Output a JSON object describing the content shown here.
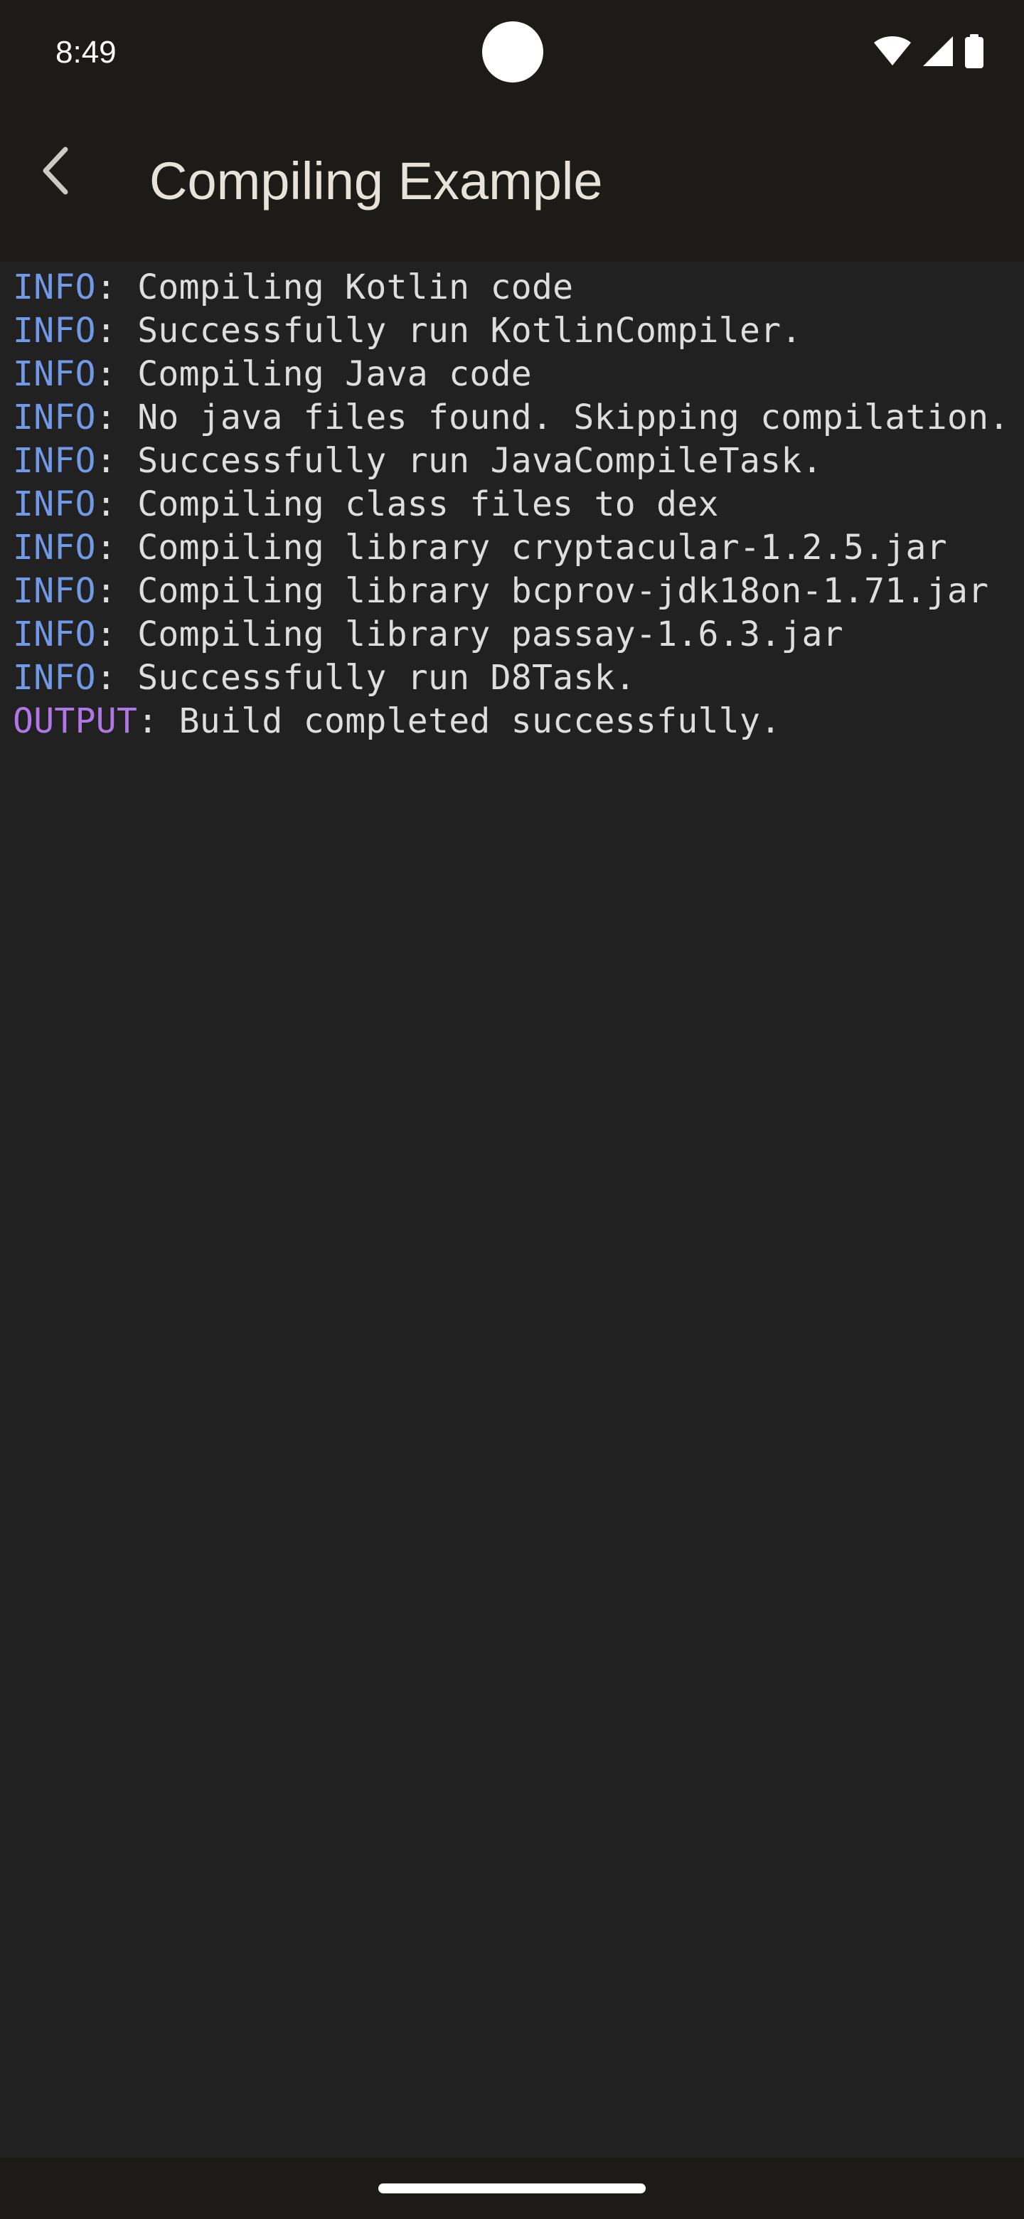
{
  "status_bar": {
    "time": "8:49",
    "icons": [
      "wifi-icon",
      "signal-icon",
      "battery-icon"
    ]
  },
  "app_bar": {
    "back_icon": "arrow-back-icon",
    "title": "Compiling Example"
  },
  "console": {
    "lines": [
      {
        "level": "INFO",
        "sep": ": ",
        "message": "Compiling Kotlin code"
      },
      {
        "level": "INFO",
        "sep": ": ",
        "message": "Successfully run KotlinCompiler."
      },
      {
        "level": "INFO",
        "sep": ": ",
        "message": "Compiling Java code"
      },
      {
        "level": "INFO",
        "sep": ": ",
        "message": "No java files found. Skipping compilation."
      },
      {
        "level": "INFO",
        "sep": ": ",
        "message": "Successfully run JavaCompileTask."
      },
      {
        "level": "INFO",
        "sep": ": ",
        "message": "Compiling class files to dex"
      },
      {
        "level": "INFO",
        "sep": ": ",
        "message": "Compiling library cryptacular-1.2.5.jar"
      },
      {
        "level": "INFO",
        "sep": ": ",
        "message": "Compiling library bcprov-jdk18on-1.71.jar"
      },
      {
        "level": "INFO",
        "sep": ": ",
        "message": "Compiling library passay-1.6.3.jar"
      },
      {
        "level": "INFO",
        "sep": ": ",
        "message": "Successfully run D8Task."
      },
      {
        "level": "OUTPUT",
        "sep": ": ",
        "message": "Build completed successfully."
      }
    ]
  },
  "colors": {
    "info": "#7199e6",
    "output": "#b277e6",
    "text": "#dedede",
    "background": "#212121",
    "bar": "#1c1b17"
  }
}
